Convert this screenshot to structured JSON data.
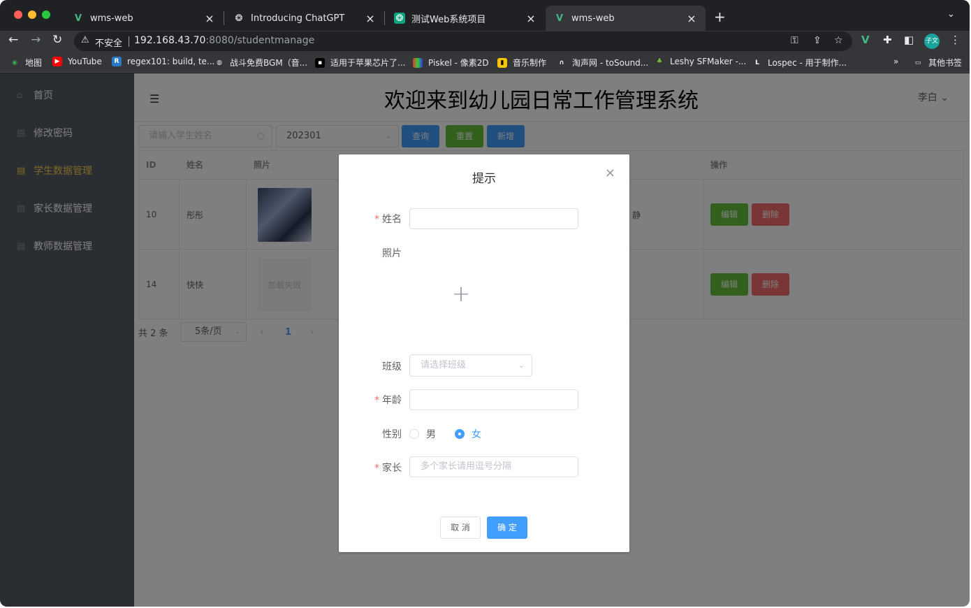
{
  "browser": {
    "tabs": [
      {
        "label": "wms-web",
        "icon": "vue-icon"
      },
      {
        "label": "Introducing ChatGPT",
        "icon": "openai-icon"
      },
      {
        "label": "测试Web系统项目",
        "icon": "openai-icon"
      },
      {
        "label": "wms-web",
        "icon": "vue-icon",
        "active": true
      }
    ],
    "address": {
      "insecure_label": "不安全",
      "host": "192.168.43.70",
      "path": ":8080/studentmanage"
    },
    "profile_label": "子文",
    "bookmarks": [
      {
        "label": "地图"
      },
      {
        "label": "YouTube"
      },
      {
        "label": "regex101: build, te..."
      },
      {
        "label": "战斗免费BGM（音..."
      },
      {
        "label": "适用于苹果芯片了..."
      },
      {
        "label": "Piskel - 像素2D"
      },
      {
        "label": "音乐制作"
      },
      {
        "label": "淘声网 - toSound..."
      },
      {
        "label": "Leshy SFMaker -..."
      },
      {
        "label": "Lospec - 用于制作..."
      }
    ],
    "bookmarks_more": "»",
    "other_bookmarks": "其他书签"
  },
  "sidebar": {
    "items": [
      {
        "label": "首页",
        "icon": "home-icon"
      },
      {
        "label": "修改密码",
        "icon": "document-icon"
      },
      {
        "label": "学生数据管理",
        "icon": "document-icon",
        "active": true
      },
      {
        "label": "家长数据管理",
        "icon": "document-icon"
      },
      {
        "label": "教师数据管理",
        "icon": "document-icon"
      }
    ]
  },
  "header": {
    "title": "欢迎来到幼儿园日常工作管理系统",
    "user": "李白"
  },
  "toolbar": {
    "search_placeholder": "请输入学生姓名",
    "class_value": "202301",
    "query_label": "查询",
    "reset_label": "重置",
    "add_label": "新增"
  },
  "table": {
    "headers": [
      "ID",
      "姓名",
      "照片",
      "操作"
    ],
    "rows": [
      {
        "id": "10",
        "name": "彤彤",
        "photo": "image",
        "partial": "静",
        "edit": "编辑",
        "delete": "删除"
      },
      {
        "id": "14",
        "name": "快快",
        "photo_failed": "加载失败",
        "edit": "编辑",
        "delete": "删除"
      }
    ]
  },
  "pager": {
    "total": "共 2 条",
    "page_size": "5条/页",
    "prev": "‹",
    "current": "1",
    "next": "›"
  },
  "dialog": {
    "title": "提示",
    "fields": {
      "name_label": "姓名",
      "photo_label": "照片",
      "class_label": "班级",
      "class_placeholder": "请选择班级",
      "age_label": "年龄",
      "gender_label": "性别",
      "gender_male": "男",
      "gender_female": "女",
      "gender_selected": "女",
      "parent_label": "家长",
      "parent_placeholder": "多个家长请用逗号分隔"
    },
    "cancel_label": "取 消",
    "ok_label": "确 定"
  },
  "colors": {
    "primary": "#409eff",
    "success": "#67c23a",
    "danger": "#f56c6c",
    "sidebar_bg": "#545c64",
    "active_menu": "#ffd04b"
  }
}
